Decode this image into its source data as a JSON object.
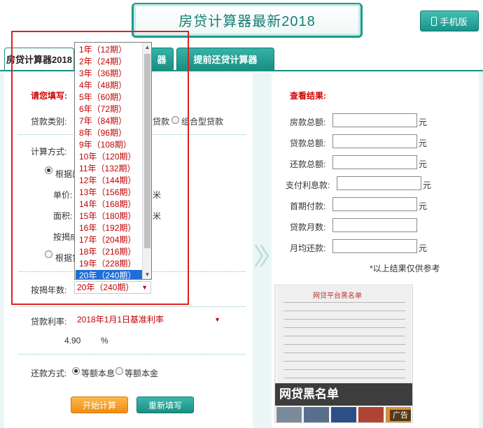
{
  "header": {
    "title": "房贷计算器最新2018",
    "mobile_button": "手机版"
  },
  "tabs": [
    {
      "label": "房贷计算器2018"
    },
    {
      "label": "器"
    },
    {
      "label": "提前还贷计算器"
    }
  ],
  "form": {
    "heading": "请您填写:",
    "loan_type_label": "贷款类别:",
    "loan_type_frag": "贷款",
    "loan_type_combo": "组合型贷款",
    "calc_method_label": "计算方式:",
    "method_by_frag": "根据面",
    "unit_price_label": "单价:",
    "unit_price_unit": "米",
    "area_label": "面积:",
    "area_unit": "米",
    "mortgage_ratio_label": "按揭成",
    "method_by2_frag": "根据贷",
    "years_label": "按揭年数:",
    "years_selected": "20年（240期）",
    "rate_label": "贷款利率:",
    "rate_selected": "2018年1月1日基准利率",
    "rate_value": "4.90",
    "rate_unit": "%",
    "repay_label": "还款方式:",
    "repay_equal_interest": "等额本息",
    "repay_equal_principal": "等额本金",
    "start_button": "开始计算",
    "reset_button": "重新填写"
  },
  "dropdown_options": [
    "1年（12期）",
    "2年（24期）",
    "3年（36期）",
    "4年（48期）",
    "5年（60期）",
    "6年（72期）",
    "7年（84期）",
    "8年（96期）",
    "9年（108期）",
    "10年（120期）",
    "11年（132期）",
    "12年（144期）",
    "13年（156期）",
    "14年（168期）",
    "15年（180期）",
    "16年（192期）",
    "17年（204期）",
    "18年（216期）",
    "19年（228期）",
    "20年（240期）"
  ],
  "results": {
    "heading": "查看结果:",
    "rows": [
      {
        "label": "房款总额:",
        "unit": "元"
      },
      {
        "label": "贷款总额:",
        "unit": "元"
      },
      {
        "label": "还款总额:",
        "unit": "元"
      },
      {
        "label": "支付利息款:",
        "unit": "元"
      },
      {
        "label": "首期付款:",
        "unit": "元"
      },
      {
        "label": "贷款月数:",
        "unit": ""
      },
      {
        "label": "月均还款:",
        "unit": "元"
      }
    ],
    "note": "*以上结果仅供参考"
  },
  "ad": {
    "paper_title": "网贷平台黑名单",
    "overlay": "网贷黑名单",
    "tag": "广告"
  }
}
